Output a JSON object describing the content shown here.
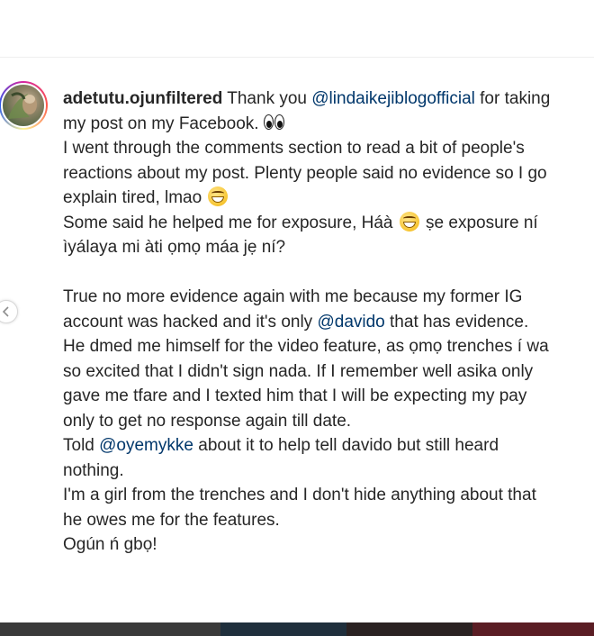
{
  "post": {
    "username": "adetutu.ojunfiltered",
    "lines": {
      "l1_text": " Thank you ",
      "l1_mention": "@lindaikejiblogofficial",
      "l1_tail": " for taking",
      "l2": "my post on my Facebook.",
      "l3": "I went through the comments section to read a bit of people's",
      "l4": "reactions about my post. Plenty people said no evidence so I go",
      "l5": "explain tired, lmao",
      "l6a": "Some said he helped me for exposure, Háà",
      "l6b": " ṣe exposure ní",
      "l7": "ìyálaya mi àti ọmọ máa jẹ ní?",
      "l8": "True no more evidence again with me because my former IG",
      "l9a": "account was hacked and it's only ",
      "l9_mention": "@davido",
      "l9b": " that has evidence.",
      "l10": "He dmed me himself for the video feature, as ọmọ trenches í wa",
      "l11": "so excited that I didn't sign nada. If I remember well asika only",
      "l12": "gave me tfare and I texted him that I will be expecting my pay",
      "l13": "only to get no response again till date.",
      "l14a": "Told ",
      "l14_mention": "@oyemykke",
      "l14b": " about it to help tell davido but still heard",
      "l15": "nothing.",
      "l16": "I'm a girl from the trenches and I don't hide anything about that",
      "l17": "he owes me for the features.",
      "l18": "Ogún ń gbọ!"
    }
  },
  "icons": {
    "eyes": "eyes-emoji",
    "laugh": "grinning-squinting-emoji",
    "carousel_prev": "chevron-left-icon"
  },
  "colors": {
    "text": "#262626",
    "mention": "#00376b",
    "background": "#ffffff"
  }
}
